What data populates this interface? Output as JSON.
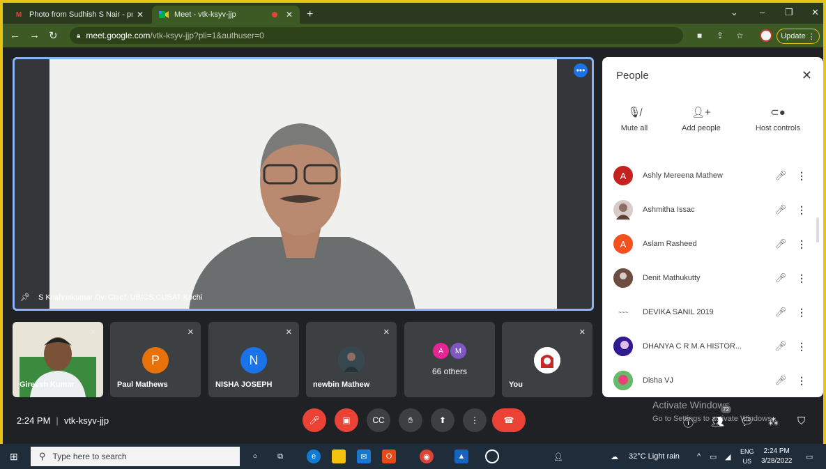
{
  "browser": {
    "tabs": [
      {
        "label": "Photo from Sudhish S Nair - proc",
        "icon": "gmail-icon"
      },
      {
        "label": "Meet - vtk-ksyv-jjp",
        "icon": "meet-icon"
      }
    ],
    "url_host": "meet.google.com",
    "url_path": "/vtk-ksyv-jjp?pli=1&authuser=0",
    "update_label": "Update",
    "accent": "#e7c316"
  },
  "main_video": {
    "speaker_label": "S Krishnakumar Dy. Chief, UBICS,CUSAT Kochi"
  },
  "tiles": [
    {
      "name": "Gireesh Kumar",
      "initial": "",
      "color": "#2e7d32"
    },
    {
      "name": "Paul Mathews",
      "initial": "P",
      "color": "#e8710a"
    },
    {
      "name": "NISHA JOSEPH",
      "initial": "N",
      "color": "#1a73e8"
    },
    {
      "name": "newbin Mathew",
      "initial": "",
      "color": "#5f6368"
    },
    {
      "name": "66 others",
      "initials": [
        "A",
        "M"
      ],
      "colors": [
        "#e52592",
        "#7e57c2"
      ]
    },
    {
      "name": "You",
      "initial": "",
      "color": "#ffffff"
    }
  ],
  "people_panel": {
    "title": "People",
    "actions": [
      {
        "label": "Mute all",
        "icon": "mic-off-icon"
      },
      {
        "label": "Add people",
        "icon": "add-person-icon"
      },
      {
        "label": "Host controls",
        "icon": "toggle-icon"
      }
    ],
    "participants": [
      {
        "name": "Ashly Mereena Mathew",
        "initial": "A",
        "color": "#c5221f"
      },
      {
        "name": "Ashmitha Issac",
        "initial": "",
        "color": "#d7ccc8"
      },
      {
        "name": "Aslam Rasheed",
        "initial": "A",
        "color": "#f4511e"
      },
      {
        "name": "Denit Mathukutty",
        "initial": "",
        "color": "#8d6e63"
      },
      {
        "name": "DEVIKA SANIL 2019",
        "initial": "",
        "color": "#ffffff"
      },
      {
        "name": "DHANYA C R M.A HISTOR...",
        "initial": "",
        "color": "#4a148c"
      },
      {
        "name": "Disha VJ",
        "initial": "",
        "color": "#43a047"
      }
    ]
  },
  "meeting_bar": {
    "time": "2:24 PM",
    "code": "vtk-ksyv-jjp",
    "participant_count": "72"
  },
  "watermark": {
    "line1": "Activate Windows",
    "line2": "Go to Settings to activate Windows."
  },
  "taskbar": {
    "search_placeholder": "Type here to search",
    "weather": "32°C  Light rain",
    "lang_top": "ENG",
    "lang_bottom": "US",
    "clock_time": "2:24 PM",
    "clock_date": "3/28/2022"
  }
}
